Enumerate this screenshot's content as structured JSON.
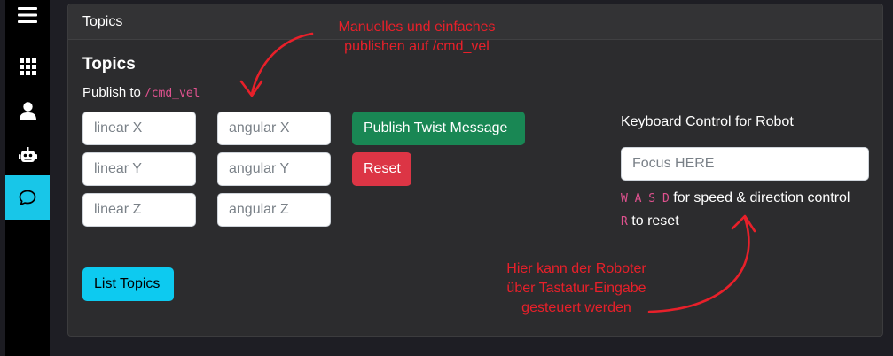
{
  "sidebar": {
    "items": [
      {
        "icon": "hamburger-menu-icon",
        "active": false
      },
      {
        "icon": "grid-icon",
        "active": false
      },
      {
        "icon": "user-icon",
        "active": false
      },
      {
        "icon": "robot-icon",
        "active": false
      },
      {
        "icon": "chat-icon",
        "active": true
      }
    ],
    "active_color": "#18c6e8"
  },
  "card": {
    "header": "Topics",
    "title": "Topics",
    "publish_label": "Publish to",
    "publish_topic": "/cmd_vel",
    "inputs": {
      "linear_x": "linear X",
      "linear_y": "linear Y",
      "linear_z": "linear Z",
      "angular_x": "angular X",
      "angular_y": "angular Y",
      "angular_z": "angular Z"
    },
    "buttons": {
      "publish": "Publish Twist Message",
      "reset": "Reset",
      "list_topics": "List Topics"
    },
    "keyboard": {
      "title": "Keyboard Control for Robot",
      "placeholder": "Focus HERE",
      "keys_wasd": "W A S D",
      "wasd_desc": "for speed & direction control",
      "key_r": "R",
      "r_desc": "to reset"
    }
  },
  "annotations": {
    "top_line1": "Manuelles und einfaches",
    "top_line2": "publishen auf /cmd_vel",
    "bottom_line1": "Hier kann der Roboter",
    "bottom_line2": "über Tastatur-Eingabe",
    "bottom_line3": "gesteuert werden",
    "color": "#e8202a"
  }
}
